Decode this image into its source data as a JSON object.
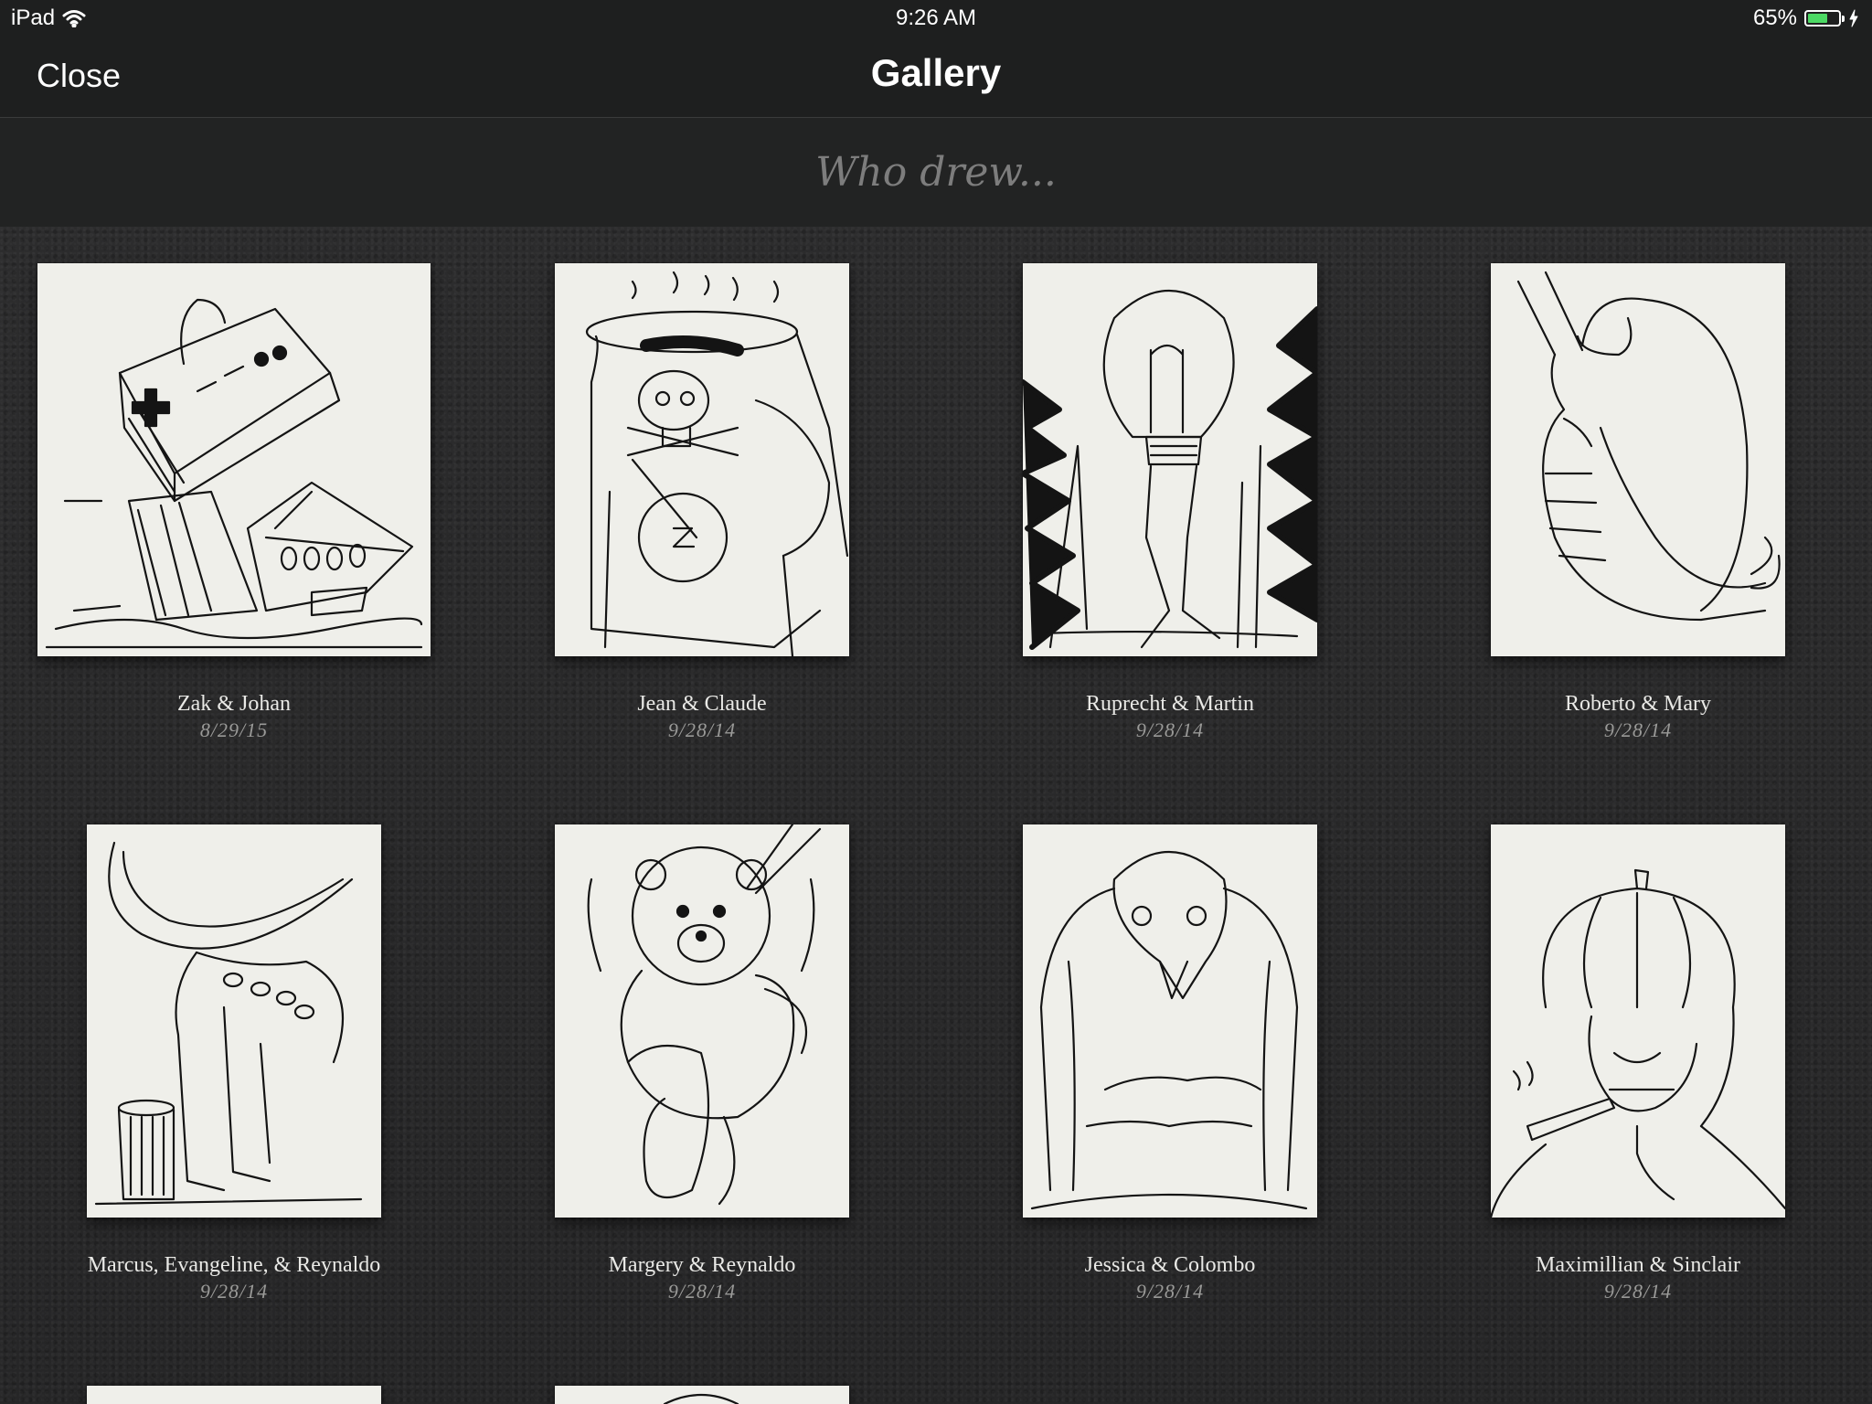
{
  "status_bar": {
    "device": "iPad",
    "time": "9:26 AM",
    "battery": "65%",
    "battery_level": 0.65,
    "icons": [
      "wifi-icon",
      "battery-icon",
      "charging-icon"
    ]
  },
  "nav": {
    "close_label": "Close",
    "title": "Gallery"
  },
  "search": {
    "placeholder": "Who drew..."
  },
  "gallery": [
    {
      "artists": "Zak & Johan",
      "date": "8/29/15",
      "subject": "controller-tank"
    },
    {
      "artists": "Jean & Claude",
      "date": "9/28/14",
      "subject": "skull-mug"
    },
    {
      "artists": "Ruprecht & Martin",
      "date": "9/28/14",
      "subject": "lightbulb-legs"
    },
    {
      "artists": "Roberto & Mary",
      "date": "9/28/14",
      "subject": "elephant-snake"
    },
    {
      "artists": "Marcus, Evangeline, & Reynaldo",
      "date": "9/28/14",
      "subject": "banana-octopus"
    },
    {
      "artists": "Margery & Reynaldo",
      "date": "9/28/14",
      "subject": "teddy-bear"
    },
    {
      "artists": "Jessica & Colombo",
      "date": "9/28/14",
      "subject": "penguin"
    },
    {
      "artists": "Maximillian & Sinclair",
      "date": "9/28/14",
      "subject": "pumpkin-head"
    },
    {
      "artists": "",
      "date": "",
      "subject": "partial"
    },
    {
      "artists": "",
      "date": "",
      "subject": "partial"
    }
  ],
  "colors": {
    "nav_background": "#1e1f1f",
    "background": "#2b2b2c",
    "paper": "#efefea",
    "battery_fill": "#4cd964"
  }
}
